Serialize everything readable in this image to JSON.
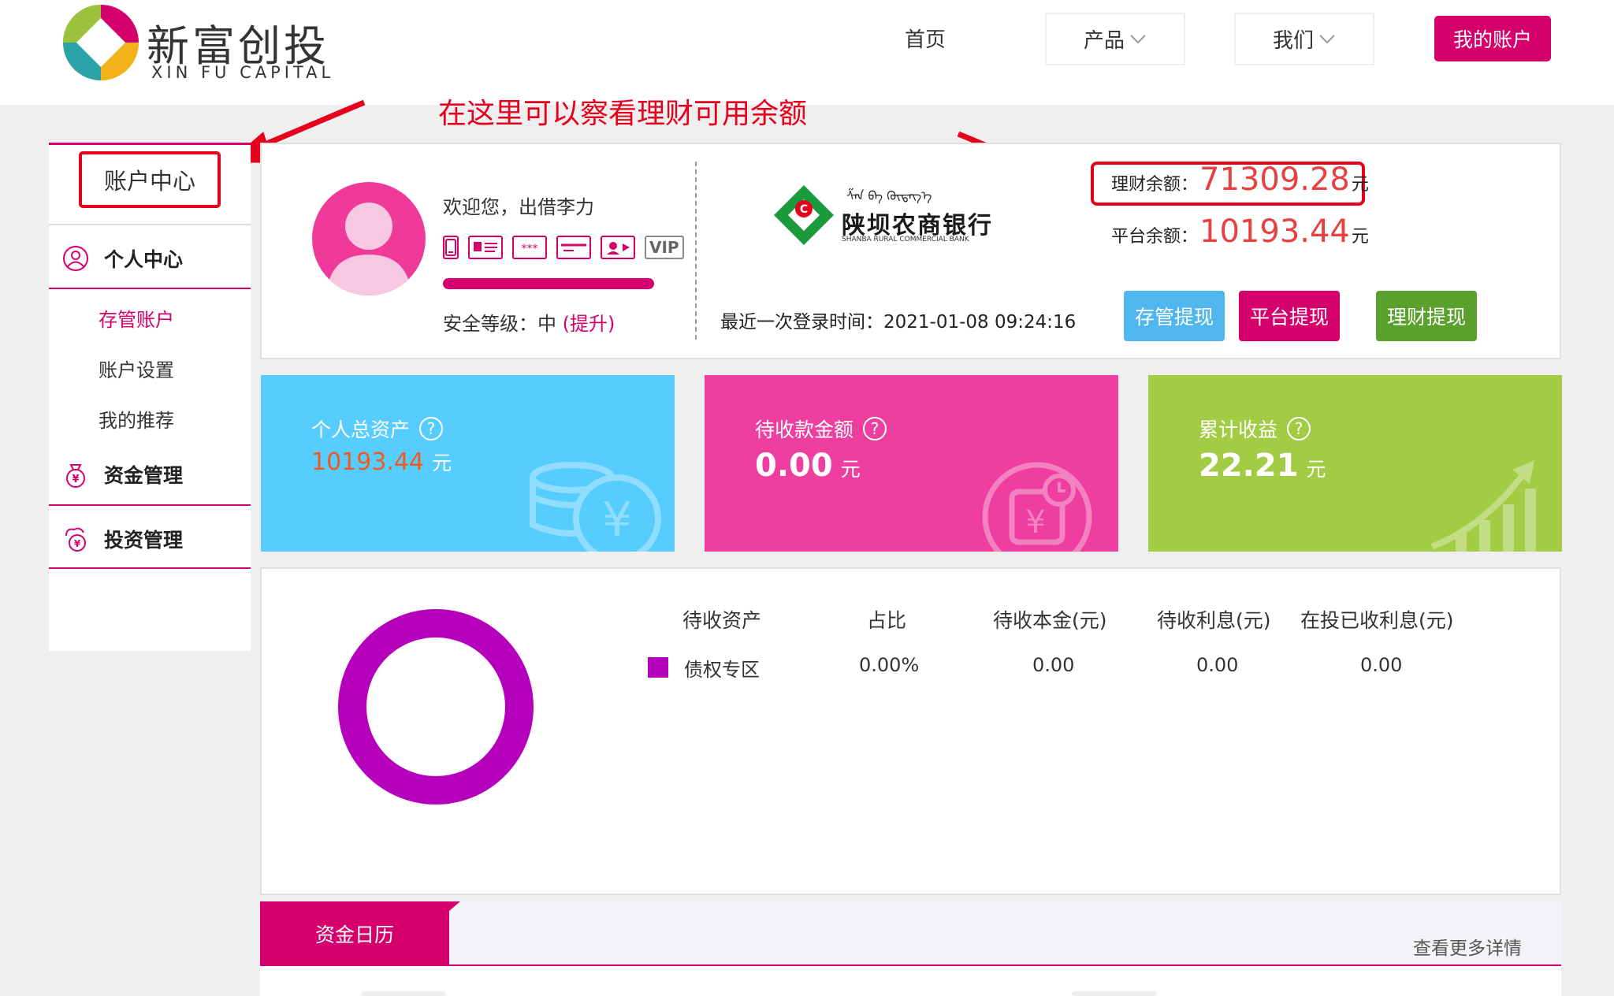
{
  "colors": {
    "brand": "#d6006d",
    "annotation": "#e6001c",
    "balance_amount": "#e84040",
    "tile_total": "#56ccff",
    "tile_receivable": "#ee3fa0",
    "tile_earnings": "#a2cc44",
    "donut": "#b500bc"
  },
  "header": {
    "logo_cn": "新富创投",
    "logo_en": "XIN FU CAPITAL",
    "nav": {
      "home": "首页",
      "products": "产品",
      "us": "我们",
      "my_account": "我的账户"
    }
  },
  "annotation": {
    "text": "在这里可以察看理财可用余额"
  },
  "sidebar": {
    "title": "账户中心",
    "sections": [
      {
        "label": "个人中心",
        "icon": "user-circle-icon",
        "items": [
          "存管账户",
          "账户设置",
          "我的推荐"
        ],
        "active_item": "存管账户"
      },
      {
        "label": "资金管理",
        "icon": "money-bag-icon",
        "items": []
      },
      {
        "label": "投资管理",
        "icon": "invest-icon",
        "items": []
      }
    ]
  },
  "profile": {
    "welcome": "欢迎您，出借李力",
    "security_icons": [
      "phone-icon",
      "id-card-icon",
      "password-icon",
      "bank-card-icon",
      "video-icon",
      "vip-icon"
    ],
    "vip_label": "VIP",
    "security_level": 1.0,
    "security_label": "安全等级：中",
    "upgrade_label": "(提升)",
    "bank": {
      "name_cn": "陕坝农商银行",
      "name_en": "SHANBA RURAL COMMERCIAL BANK",
      "mongolian": "ᠱᠠᠨ ᠪᠠ ᠬᠥᠳᠡᠭ᠎ᠡ"
    },
    "last_login": "最近一次登录时间：2021-01-08 09:24:16",
    "finance_balance_label": "理财余额：",
    "finance_balance": "71309.28",
    "platform_balance_label": "平台余额：",
    "platform_balance": "10193.44",
    "currency_unit": "元",
    "buttons": {
      "custody_withdraw": "存管提现",
      "platform_withdraw": "平台提现",
      "finance_withdraw": "理财提现"
    }
  },
  "tiles": {
    "total_assets": {
      "label": "个人总资产",
      "value": "10193.44",
      "unit": "元",
      "icon": "coins-yen-icon"
    },
    "receivable": {
      "label": "待收款金额",
      "value": "0.00",
      "unit": "元",
      "icon": "calendar-yen-icon"
    },
    "earnings": {
      "label": "累计收益",
      "value": "22.21",
      "unit": "元",
      "icon": "growth-chart-icon"
    },
    "help_symbol": "?"
  },
  "assets_table": {
    "headers": [
      "待收资产",
      "占比",
      "待收本金(元)",
      "待收利息(元)",
      "在投已收利息(元)"
    ],
    "rows": [
      [
        "债权专区",
        "0.00%",
        "0.00",
        "0.00",
        "0.00"
      ]
    ]
  },
  "calendar": {
    "tab": "资金日历",
    "more": "查看更多详情"
  }
}
